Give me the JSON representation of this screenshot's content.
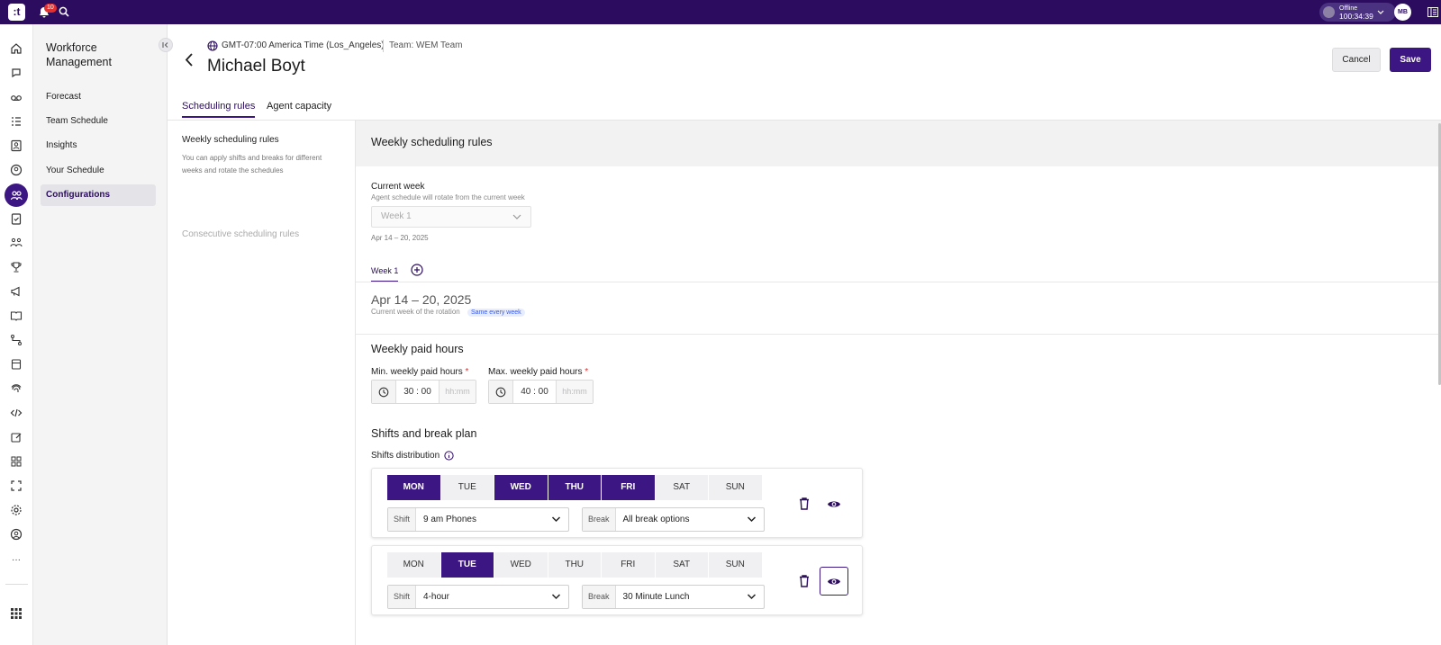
{
  "topbar": {
    "logo_text": ":t",
    "notification_count": "10",
    "status_label": "Offline",
    "status_timer": "100:34:39",
    "avatar_initials": "MB"
  },
  "rail": {
    "icons": [
      "home-icon",
      "chat-bubble-icon",
      "voicemail-icon",
      "list-icon",
      "contact-card-icon",
      "agent-icon",
      "wfm-team-icon",
      "clipboard-icon",
      "people-icon",
      "trophy-icon",
      "megaphone-icon",
      "book-icon",
      "flow-icon",
      "database-icon",
      "fingerprint-icon",
      "code-icon",
      "edit-icon",
      "widgets-icon",
      "screen-capture-icon",
      "gear-icon",
      "support-icon",
      "more-icon",
      "apps-grid-icon"
    ],
    "more_label": "···"
  },
  "nav": {
    "title": "Workforce Management",
    "items": [
      {
        "label": "Forecast"
      },
      {
        "label": "Team Schedule"
      },
      {
        "label": "Insights"
      },
      {
        "label": "Your Schedule"
      },
      {
        "label": "Configurations"
      }
    ]
  },
  "header": {
    "timezone": "GMT-07:00 America Time (Los_Angeles)",
    "team": "Team: WEM Team",
    "name": "Michael Boyt",
    "cancel_label": "Cancel",
    "save_label": "Save"
  },
  "tabs": {
    "scheduling": "Scheduling rules",
    "capacity": "Agent capacity"
  },
  "left": {
    "weekly_title": "Weekly scheduling rules",
    "weekly_desc": "You can apply shifts and breaks for different weeks and rotate the schedules",
    "consecutive": "Consecutive scheduling rules"
  },
  "main": {
    "title": "Weekly scheduling rules",
    "current_week_title": "Current week",
    "current_week_sub": "Agent schedule will rotate from the current week",
    "current_week_value": "Week 1",
    "current_week_range": "Apr 14 – 20, 2025",
    "week_tab": "Week 1",
    "week_range": "Apr 14 – 20, 2025",
    "week_sub": "Current week of the rotation",
    "week_badge": "Same every week",
    "paid_hours_title": "Weekly paid hours",
    "min_label": "Min. weekly paid hours",
    "max_label": "Max. weekly paid hours",
    "required_mark": "*",
    "min_value": "30 : 00",
    "max_value": "40 : 00",
    "hours_placeholder": "hh:mm",
    "shifts_title": "Shifts and break plan",
    "shifts_label": "Shifts distribution",
    "shift_prefix": "Shift",
    "break_prefix": "Break"
  },
  "plans": [
    {
      "days": [
        {
          "label": "MON",
          "on": true
        },
        {
          "label": "TUE",
          "on": false
        },
        {
          "label": "WED",
          "on": true
        },
        {
          "label": "THU",
          "on": true
        },
        {
          "label": "FRI",
          "on": true
        },
        {
          "label": "SAT",
          "on": false
        },
        {
          "label": "SUN",
          "on": false
        }
      ],
      "shift": "9 am Phones",
      "break": "All break options"
    },
    {
      "days": [
        {
          "label": "MON",
          "on": false
        },
        {
          "label": "TUE",
          "on": true
        },
        {
          "label": "WED",
          "on": false
        },
        {
          "label": "THU",
          "on": false
        },
        {
          "label": "FRI",
          "on": false
        },
        {
          "label": "SAT",
          "on": false
        },
        {
          "label": "SUN",
          "on": false
        }
      ],
      "shift": "4-hour",
      "break": "30 Minute Lunch"
    }
  ],
  "colors": {
    "brand": "#2b0c5e",
    "accent": "#3c1682",
    "badge": "#e03131"
  }
}
